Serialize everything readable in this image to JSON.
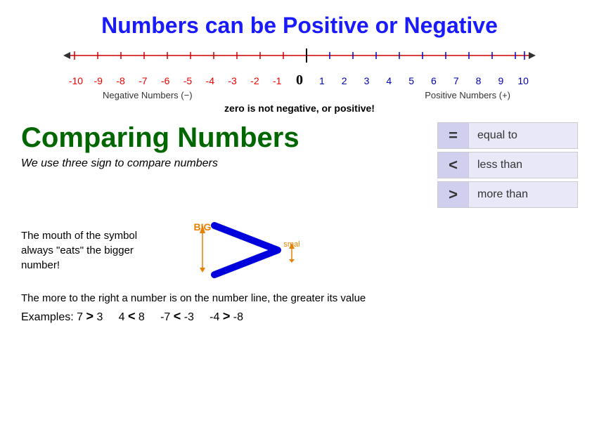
{
  "title": "Numbers can be Positive or Negative",
  "numberLine": {
    "numbers": [
      "-10",
      "-9",
      "-8",
      "-7",
      "-6",
      "-5",
      "-4",
      "-3",
      "-2",
      "-1",
      "0",
      "1",
      "2",
      "3",
      "4",
      "5",
      "6",
      "7",
      "8",
      "9",
      "10"
    ],
    "negativeLabel": "Negative Numbers (−)",
    "positiveLabel": "Positive Numbers (+)",
    "zeroNote": "zero is not negative, or positive!"
  },
  "comparing": {
    "title": "Comparing Numbers",
    "subtitle": "We use three sign to compare numbers",
    "symbols": [
      {
        "symbol": "=",
        "label": "equal to"
      },
      {
        "symbol": "<",
        "label": "less than"
      },
      {
        "symbol": ">",
        "label": "more than"
      }
    ]
  },
  "mouthSection": {
    "text": "The mouth of the symbol always \"eats\" the bigger number!",
    "bigLabel": "BIG",
    "smallLabel": "smal"
  },
  "bottomNote": "The more to the right a number is on the number line, the greater its value",
  "examples": {
    "label": "Examples:",
    "items": [
      {
        "a": "7",
        "sym": ">",
        "b": "3"
      },
      {
        "a": "4",
        "sym": "<",
        "b": "8"
      },
      {
        "a": "-7",
        "sym": "<",
        "b": "-3"
      },
      {
        "a": "-4",
        "sym": ">",
        "b": "-8"
      }
    ]
  }
}
